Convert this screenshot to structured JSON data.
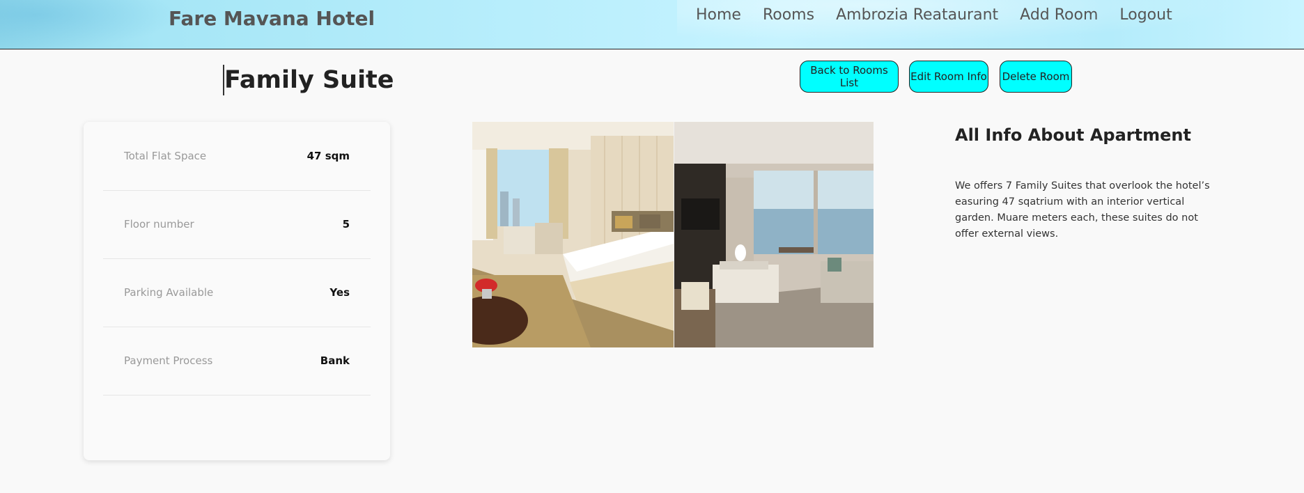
{
  "header": {
    "brand": "Fare Mavana Hotel",
    "nav": [
      "Home",
      "Rooms",
      "Ambrozia Reataurant",
      "Add Room",
      "Logout"
    ]
  },
  "room": {
    "title": "Family Suite",
    "actions": {
      "back": "Back to Rooms List",
      "edit": "Edit Room Info",
      "delete": "Delete Room"
    },
    "details": [
      {
        "label": "Total Flat Space",
        "value": "47 sqm"
      },
      {
        "label": "Floor number",
        "value": "5"
      },
      {
        "label": "Parking Available",
        "value": "Yes"
      },
      {
        "label": "Payment Process",
        "value": "Bank"
      }
    ],
    "info_title": "All Info About Apartment",
    "info_text": "We offers 7 Family Suites that overlook the hotel’s easuring 47 sqatrium with an interior vertical garden. Muare meters each, these suites do not offer external views."
  },
  "colors": {
    "button_bg": "#00ffff",
    "header_bg": "#b8eefc"
  }
}
